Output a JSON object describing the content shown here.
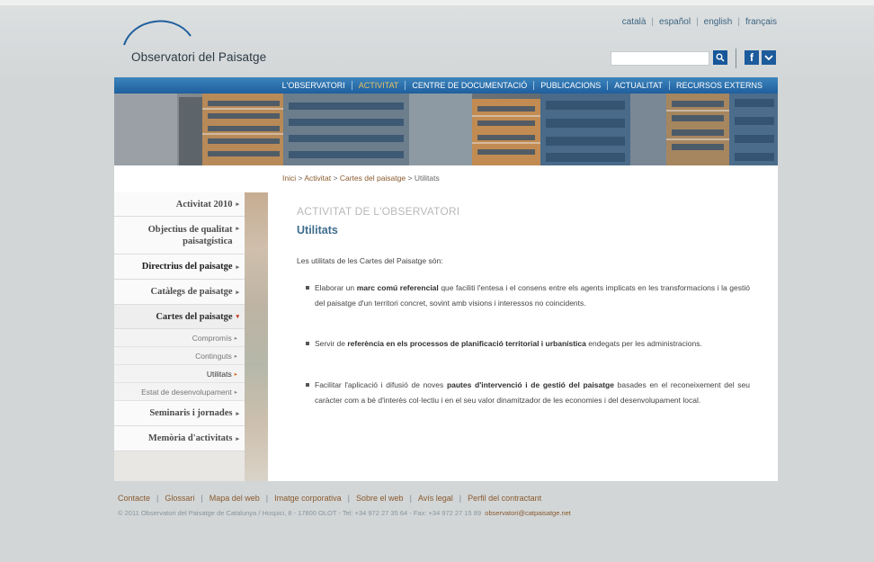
{
  "header": {
    "logo_text": "Observatori del Paisatge",
    "languages": [
      "català",
      "español",
      "english",
      "français"
    ],
    "search": {
      "value": "",
      "placeholder": ""
    }
  },
  "nav": {
    "items": [
      {
        "label": "L'OBSERVATORI",
        "active": false
      },
      {
        "label": "ACTIVITAT",
        "active": true
      },
      {
        "label": "CENTRE DE DOCUMENTACIÓ",
        "active": false
      },
      {
        "label": "PUBLICACIONS",
        "active": false
      },
      {
        "label": "ACTUALITAT",
        "active": false
      },
      {
        "label": "RECURSOS EXTERNS",
        "active": false
      }
    ]
  },
  "breadcrumb": {
    "items": [
      "Inici",
      "Activitat",
      "Cartes del paisatge",
      "Utilitats"
    ],
    "separator": ">"
  },
  "sidebar": {
    "items": [
      {
        "label": "Activitat 2010"
      },
      {
        "label": "Objectius de qualitat paisatgística"
      },
      {
        "label": "Directrius del paisatge"
      },
      {
        "label": "Catàlegs de paisatge"
      },
      {
        "label": "Cartes del paisatge"
      },
      {
        "label": "Compromís"
      },
      {
        "label": "Continguts"
      },
      {
        "label": "Utilitats"
      },
      {
        "label": "Estat de desenvolupament"
      },
      {
        "label": "Seminaris i jornades"
      },
      {
        "label": "Memòria d'activitats"
      }
    ],
    "arrow": "▸",
    "arrow_down": "▾"
  },
  "main": {
    "section_title": "ACTIVITAT DE L'OBSERVATORI",
    "page_title": "Utilitats",
    "intro": "Les utilitats de les Cartes del Paisatge són:",
    "bullets": [
      {
        "pre": "Elaborar un ",
        "bold": "marc comú referencial",
        "post": " que faciliti l'entesa i el consens entre els agents implicats en les transformacions i la gestió del paisatge d'un territori concret, sovint amb visions i interessos no coincidents."
      },
      {
        "pre": "Servir de ",
        "bold": "referència en els processos de planificació territorial i urbanística",
        "post": " endegats per les administracions."
      },
      {
        "pre": "Facilitar l'aplicació i difusió de noves ",
        "bold": "pautes d'intervenció i de gestió del paisatge",
        "post": " basades en el reconeixement del seu caràcter com a bé d'interès col·lectiu i en el seu valor dinamitzador de les economies i del desenvolupament local."
      }
    ]
  },
  "footer": {
    "links": [
      "Contacte",
      "Glossari",
      "Mapa del web",
      "Imatge corporativa",
      "Sobre el web",
      "Avís legal",
      "Perfil del contractant"
    ],
    "copyright": "© 2011 Observatori del Paisatge de Catalunya / Hospici, 8 - 17800 OLOT - Tel: +34 972 27 35 64 - Fax: +34 972 27 15 89",
    "email": "observatori@catpaisatge.net"
  },
  "icons": {
    "search": "search-icon",
    "facebook": "facebook-icon",
    "social2": "dropdown-icon"
  },
  "colors": {
    "nav_blue": "#1f5f9d",
    "nav_active": "#e8c061",
    "link_brown": "#8a5a2e",
    "title_blue": "#3f6d8d"
  }
}
